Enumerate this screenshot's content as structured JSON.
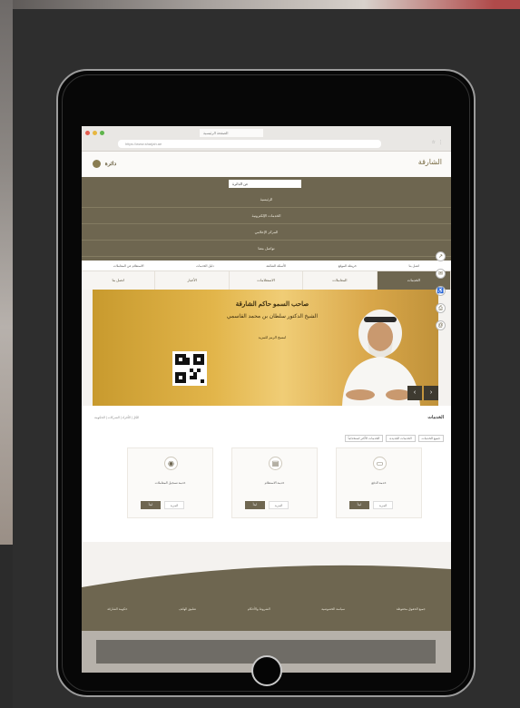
{
  "browser": {
    "tab_title": "الصفحة الرئيسية",
    "url": "https://www.sharjah.ae",
    "icons": [
      "star-icon",
      "menu-icon"
    ]
  },
  "site": {
    "logo_left": "دائرة",
    "logo_right": "الشارقة",
    "menu_head": "عن الدائرة"
  },
  "menu_rows": [
    "الرئيسية",
    "الخدمات الإلكترونية",
    "المركز الإعلامي",
    "تواصل معنا"
  ],
  "nav_links": [
    "الاستعلام عن المعاملات",
    "دليل الخدمات",
    "الأسئلة الشائعة",
    "خريطة الموقع",
    "اتصل بنا"
  ],
  "tabs": [
    "الخدمات",
    "المعاملات",
    "الاستعلامات",
    "الأخبار",
    "اتصل بنا"
  ],
  "banner": {
    "line1": "صاحب السمو حاكم الشارقة",
    "line2": "الشيخ الدكتور سلطان بن محمد القاسمي",
    "line3": "امسح الرمز للمزيد"
  },
  "side_icons": [
    "share-icon",
    "chat-icon",
    "accessibility-icon",
    "print-icon",
    "mail-icon"
  ],
  "services": {
    "title": "الخدمات",
    "filters": "الكل  |  الأفراد  |  الشركات  |  الحكومة",
    "tabs": [
      "الخدمات الأكثر استخداماً",
      "الخدمات الجديدة",
      "جميع الخدمات"
    ],
    "cards": [
      {
        "name": "خدمة تسجيل المعاملات",
        "btn_primary": "ابدأ",
        "btn_secondary": "المزيد"
      },
      {
        "name": "خدمة الاستعلام",
        "btn_primary": "ابدأ",
        "btn_secondary": "المزيد"
      },
      {
        "name": "خدمة الدفع",
        "btn_primary": "ابدأ",
        "btn_secondary": "المزيد"
      }
    ]
  },
  "footer": {
    "items": [
      "حكومة الشارقة",
      "تطبيق الهاتف",
      "الشروط والأحكام",
      "سياسة الخصوصية",
      "جميع الحقوق محفوظة"
    ]
  },
  "colors": {
    "brand": "#6e6650",
    "banner_gold": "#e2b54a",
    "device": "#070707"
  }
}
